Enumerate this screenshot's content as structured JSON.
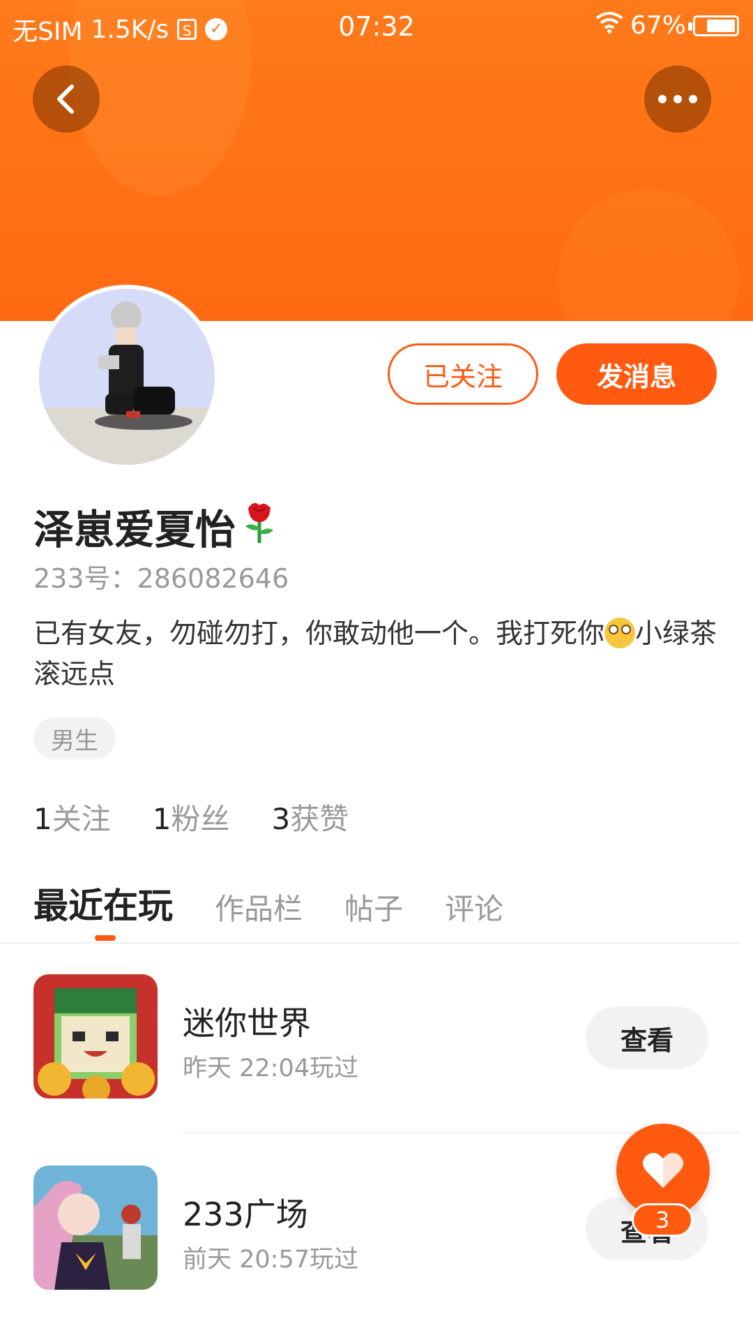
{
  "status_bar": {
    "carrier": "无SIM",
    "speed": "1.5K/s",
    "sd_icon": "sd-card-icon",
    "time": "07:32",
    "battery": "67%",
    "battery_level": 0.67
  },
  "header": {
    "back_icon": "chevron-left-icon",
    "more_icon": "more-dots-icon"
  },
  "profile": {
    "follow_button": "已关注",
    "message_button": "发消息",
    "username": "泽崽爱夏怡",
    "uid": "233号：286082646",
    "bio_part1": "已有女友，勿碰勿打，你敢动他一个。我打死你",
    "bio_part2": "小绿茶滚远点",
    "gender_tag": "男生",
    "stats": [
      {
        "num": "1",
        "label": "关注"
      },
      {
        "num": "1",
        "label": "粉丝"
      },
      {
        "num": "3",
        "label": "获赞"
      }
    ]
  },
  "tabs": [
    "最近在玩",
    "作品栏",
    "帖子",
    "评论"
  ],
  "games": [
    {
      "name": "迷你世界",
      "time": "昨天 22:04玩过",
      "button": "查看"
    },
    {
      "name": "233广场",
      "time": "前天 20:57玩过",
      "button": "查看"
    }
  ],
  "like_fab": {
    "icon": "heart-icon",
    "count": "3"
  },
  "colors": {
    "accent": "#ff5a0f",
    "banner": "#ff7a1a"
  }
}
